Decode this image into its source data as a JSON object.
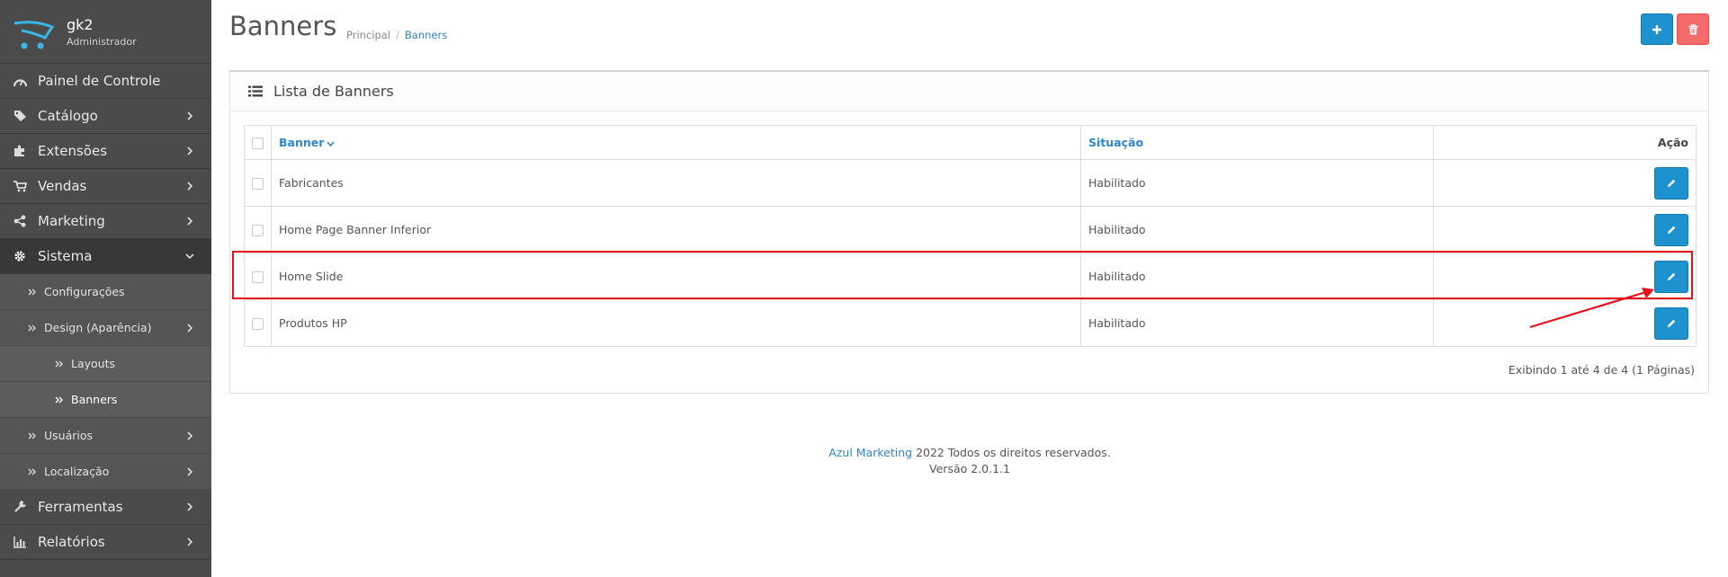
{
  "brand": {
    "name": "gk2",
    "role": "Administrador"
  },
  "sidebar": {
    "items": [
      {
        "label": "Painel de Controle",
        "icon": "dashboard-icon"
      },
      {
        "label": "Catálogo",
        "icon": "tags-icon"
      },
      {
        "label": "Extensões",
        "icon": "puzzle-icon"
      },
      {
        "label": "Vendas",
        "icon": "cart-icon"
      },
      {
        "label": "Marketing",
        "icon": "share-icon"
      },
      {
        "label": "Sistema",
        "icon": "gear-icon",
        "active": true
      },
      {
        "label": "Ferramentas",
        "icon": "wrench-icon"
      },
      {
        "label": "Relatórios",
        "icon": "bar-chart-icon"
      }
    ],
    "sistema_sub": [
      {
        "label": "Configurações"
      },
      {
        "label": "Design (Aparência)"
      },
      {
        "label": "Layouts"
      },
      {
        "label": "Banners"
      },
      {
        "label": "Usuários"
      },
      {
        "label": "Localização"
      }
    ]
  },
  "header": {
    "title": "Banners",
    "breadcrumb": {
      "home": "Principal",
      "separator": "/",
      "current": "Banners"
    }
  },
  "toolbar": {
    "add_icon": "plus-icon",
    "delete_icon": "trash-icon"
  },
  "panel": {
    "title": "Lista de Banners",
    "columns": {
      "banner": "Banner",
      "status": "Situação",
      "action": "Ação"
    },
    "rows": [
      {
        "name": "Fabricantes",
        "status": "Habilitado"
      },
      {
        "name": "Home Page Banner Inferior",
        "status": "Habilitado"
      },
      {
        "name": "Home Slide",
        "status": "Habilitado"
      },
      {
        "name": "Produtos HP",
        "status": "Habilitado"
      }
    ],
    "pagination": "Exibindo 1 até 4 de 4 (1 Páginas)"
  },
  "footer": {
    "link": "Azul Marketing",
    "text": "2022 Todos os direitos reservados.",
    "version": "Versão 2.0.1.1"
  },
  "colors": {
    "primary": "#1e91cf",
    "danger": "#f56b6b",
    "sidebar": "#4b4b4b",
    "link": "#2e87c7",
    "annotation": "#e8101a"
  }
}
